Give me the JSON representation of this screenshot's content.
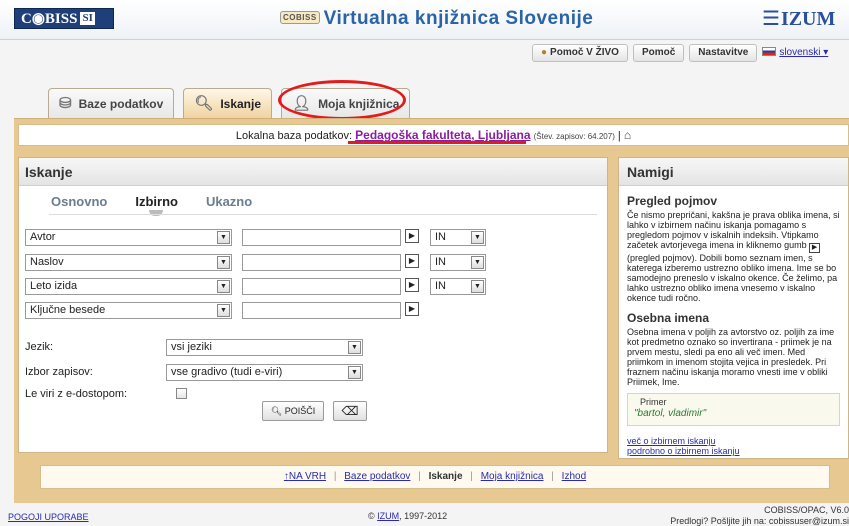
{
  "header": {
    "logo_text": "C◉BISS",
    "logo_suffix": "SI",
    "badge": "COBISS",
    "title": "Virtualna knjižnica Slovenije",
    "izum": "IZUM"
  },
  "top_buttons": {
    "live_help": "Pomoč V ŽIVO",
    "help": "Pomoč",
    "settings": "Nastavitve",
    "language": "slovenski"
  },
  "tabs": [
    {
      "label": "Baze podatkov",
      "icon": "database-icon"
    },
    {
      "label": "Iskanje",
      "icon": "magnifier-icon"
    },
    {
      "label": "Moja knjižnica",
      "icon": "user-icon"
    }
  ],
  "db_bar": {
    "prefix": "Lokalna baza podatkov:",
    "name": "Pedagoška fakulteta, Ljubljana",
    "count": "(Štev. zapisov: 64.207)",
    "separator": "|"
  },
  "search": {
    "title": "Iskanje",
    "subtabs": [
      "Osnovno",
      "Izbirno",
      "Ukazno"
    ],
    "rows": [
      {
        "field": "Avtor",
        "operator": "IN"
      },
      {
        "field": "Naslov",
        "operator": "IN"
      },
      {
        "field": "Leto izida",
        "operator": "IN"
      },
      {
        "field": "Ključne besede",
        "operator": ""
      }
    ],
    "language_label": "Jezik:",
    "language_value": "vsi jeziki",
    "records_label": "Izbor zapisov:",
    "records_value": "vse gradivo (tudi e-viri)",
    "eresources_label": "Le viri z e-dostopom:",
    "search_button": "POIŠČI",
    "clear_icon": "eraser-icon"
  },
  "hints": {
    "title": "Namigi",
    "h1": "Pregled pojmov",
    "p1a": "Če nismo prepričani, kakšna je prava oblika imena, si lahko v izbirnem načinu iskanja pomagamo s pregledom pojmov v iskalnih indeksih. Vtipkamo začetek avtorjevega imena in kliknemo gumb",
    "p1b": "(pregled pojmov). Dobili bomo seznam imen, s katerega izberemo ustrezno obliko imena. Ime se bo samodejno preneslo v iskalno okence. Če želimo, pa lahko ustrezno obliko imena vnesemo v iskalno okence tudi ročno.",
    "h2": "Osebna imena",
    "p2": "Osebna imena v poljih za avtorstvo oz. poljih za ime kot predmetno oznako so invertirana - priimek je na prvem mestu, sledi pa eno ali več imen. Med priimkom in imenom stojita vejica in presledek. Pri fraznem načinu iskanja moramo vnesti ime v obliki Priimek, Ime.",
    "example_label": "Primer",
    "example_value": "\"bartol, vladimir\"",
    "link1": "več o izbirnem iskanju",
    "link2": "podrobno o izbirnem iskanju"
  },
  "bottom_nav": {
    "top": "NA VRH",
    "db": "Baze podatkov",
    "search": "Iskanje",
    "library": "Moja knjižnica",
    "exit": "Izhod"
  },
  "footer": {
    "terms": "POGOJI UPORABE",
    "copy_prefix": "© ",
    "copy_link": "IZUM",
    "copy_suffix": ", 1997-2012",
    "version": "COBISS/OPAC, V6.0",
    "feedback": "Predlogi? Pošljite jih na: cobissuser@izum.si"
  }
}
